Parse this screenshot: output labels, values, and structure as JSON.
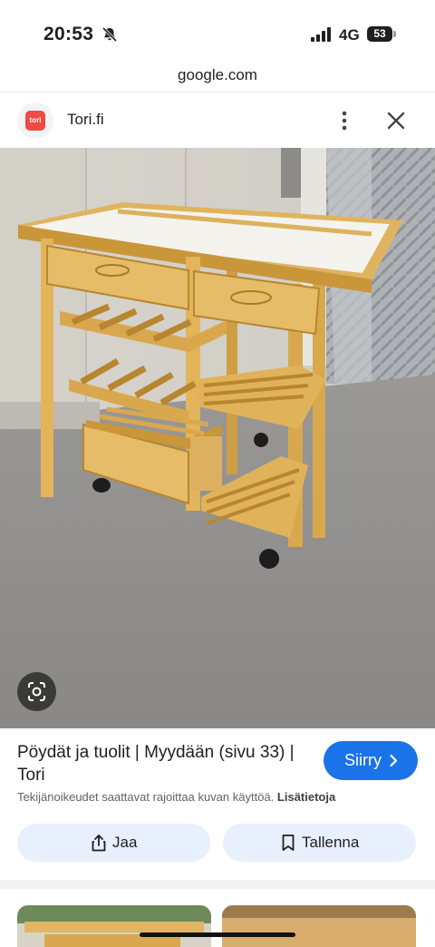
{
  "status_bar": {
    "time": "20:53",
    "network": "4G",
    "battery": "53",
    "icons": [
      "bell-slash-icon",
      "cellular-signal-icon",
      "battery-icon"
    ]
  },
  "browser": {
    "url": "google.com"
  },
  "source": {
    "name": "Tori.fi",
    "favicon_text": "tori",
    "favicon_color": "#f04a44"
  },
  "image": {
    "description_icon": "lens-icon"
  },
  "result": {
    "title": "Pöydät ja tuolit | Myydään (sivu 33) | Tori",
    "visit_label": "Siirry",
    "copyright_text": "Tekijänoikeudet saattavat rajoittaa kuvan käyttöä.",
    "learn_more": "Lisätietoja"
  },
  "actions": {
    "share_label": "Jaa",
    "save_label": "Tallenna"
  },
  "colors": {
    "accent": "#1a73e8",
    "action_bg": "#e8effd"
  }
}
